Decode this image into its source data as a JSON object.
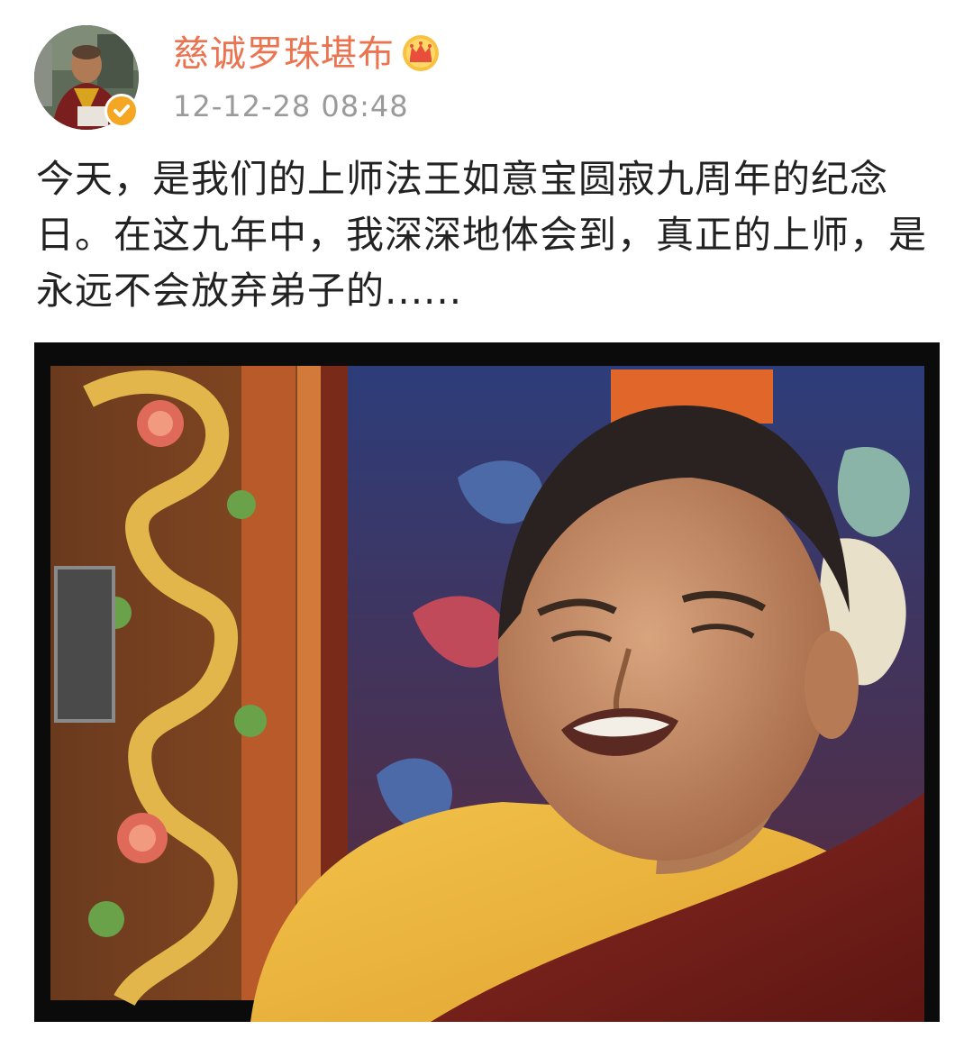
{
  "author": {
    "name": "慈诚罗珠堪布",
    "badge": "crown-icon",
    "verified": "verified-icon",
    "avatar_alt": "avatar"
  },
  "post": {
    "timestamp": "12-12-28 08:48",
    "text": "今天，是我们的上师法王如意宝圆寂九周年的纪念日。在这九年中，我深深地体会到，真正的上师，是永远不会放弃弟子的......"
  },
  "colors": {
    "username": "#eb7350",
    "timestamp": "#9a9a9a",
    "text": "#222222",
    "verified_badge": "#f5a623"
  }
}
